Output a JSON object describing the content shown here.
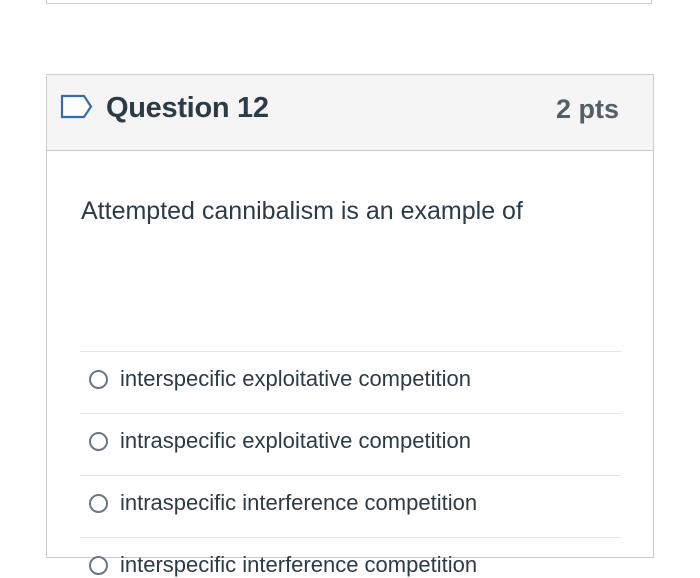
{
  "question": {
    "title": "Question 12",
    "points": "2 pts",
    "flag_icon": "bookmark-flag-icon",
    "text": "Attempted cannibalism is an example of",
    "answers": [
      {
        "label": "interspecific exploitative competition",
        "selected": false
      },
      {
        "label": "intraspecific exploitative competition",
        "selected": false
      },
      {
        "label": "intraspecific interference competition",
        "selected": false
      },
      {
        "label": "interspecific interference competition",
        "selected": false
      }
    ]
  },
  "colors": {
    "header_bg": "#f5f5f5",
    "border": "#c7cdd1",
    "text": "#2d3b45",
    "flag": "#2d3b45",
    "points": "#545f68"
  }
}
